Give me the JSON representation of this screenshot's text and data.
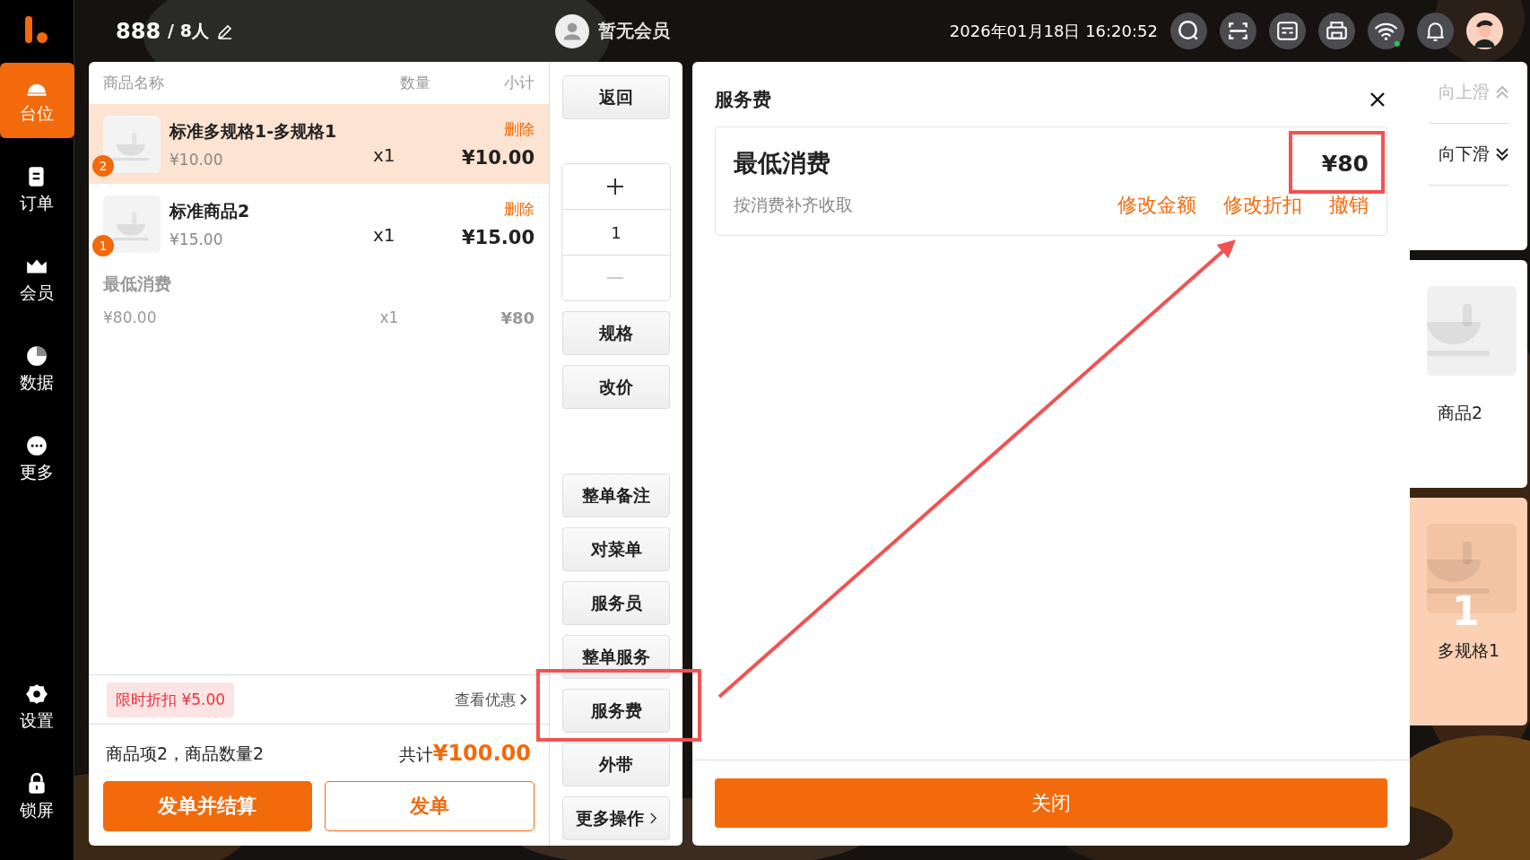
{
  "sidebar": {
    "items": [
      {
        "label": "台位",
        "selected": true
      },
      {
        "label": "订单",
        "selected": false
      },
      {
        "label": "会员",
        "selected": false
      },
      {
        "label": "数据",
        "selected": false
      },
      {
        "label": "更多",
        "selected": false
      }
    ],
    "bottom_items": [
      {
        "label": "设置",
        "selected": false
      },
      {
        "label": "锁屏",
        "selected": false
      }
    ]
  },
  "topbar": {
    "table": "888",
    "guests": "/ 8人",
    "member": "暂无会员",
    "datetime": "2026年01月18日 16:20:52",
    "icons": [
      {
        "kind": "search"
      },
      {
        "kind": "scan"
      },
      {
        "kind": "list"
      },
      {
        "kind": "printer"
      },
      {
        "kind": "wifi",
        "online": true
      },
      {
        "kind": "bell"
      }
    ]
  },
  "cart": {
    "columns": [
      "商品名称",
      "数量",
      "小计"
    ],
    "items": [
      {
        "name": "标准多规格1-多规格1",
        "price": "¥10.00",
        "qty": "x1",
        "subtotal": "¥10.00",
        "action": "删除",
        "badge": "2",
        "selected": true
      },
      {
        "name": "标准商品2",
        "price": "¥15.00",
        "qty": "x1",
        "subtotal": "¥15.00",
        "action": "删除",
        "badge": "1",
        "selected": false
      }
    ],
    "fee": {
      "name": "最低消费",
      "price": "¥80.00",
      "qty": "x1",
      "subtotal": "¥80"
    },
    "promo": {
      "tag": "限时折扣 ¥5.00",
      "link": "查看优惠"
    },
    "summary": "商品项2，商品数量2",
    "total_label": "共计",
    "total": "¥100.00",
    "buttons": [
      {
        "label": "发单并结算",
        "kind": "primary"
      },
      {
        "label": "发单",
        "kind": "outline"
      }
    ]
  },
  "actions": {
    "back": "返回",
    "stepper": {
      "value": "1",
      "minus_disabled": true
    },
    "buttons_top": [
      {
        "label": "规格"
      },
      {
        "label": "改价"
      }
    ],
    "buttons_bottom": [
      {
        "label": "整单备注",
        "kind": "plain"
      },
      {
        "label": "对菜单",
        "kind": "plain"
      },
      {
        "label": "服务员",
        "kind": "plain"
      },
      {
        "label": "整单服务",
        "kind": "plain"
      },
      {
        "label": "服务费",
        "kind": "plain"
      },
      {
        "label": "外带",
        "kind": "plain"
      },
      {
        "label": "更多操作",
        "kind": "more"
      }
    ]
  },
  "dialog": {
    "title": "服务费",
    "fee": {
      "name": "最低消费",
      "amount": "¥80",
      "note": "按消费补齐收取",
      "actions": [
        "修改金额",
        "修改折扣",
        "撤销"
      ]
    },
    "close_button": "关闭"
  },
  "side_strip": {
    "scroll": [
      {
        "label": "向上滑",
        "disabled": true
      },
      {
        "label": "向下滑",
        "disabled": false
      }
    ],
    "cards": [
      {
        "name": "商品2",
        "selected": false
      },
      {
        "name": "多规格1",
        "count": "1",
        "selected": true
      }
    ]
  }
}
